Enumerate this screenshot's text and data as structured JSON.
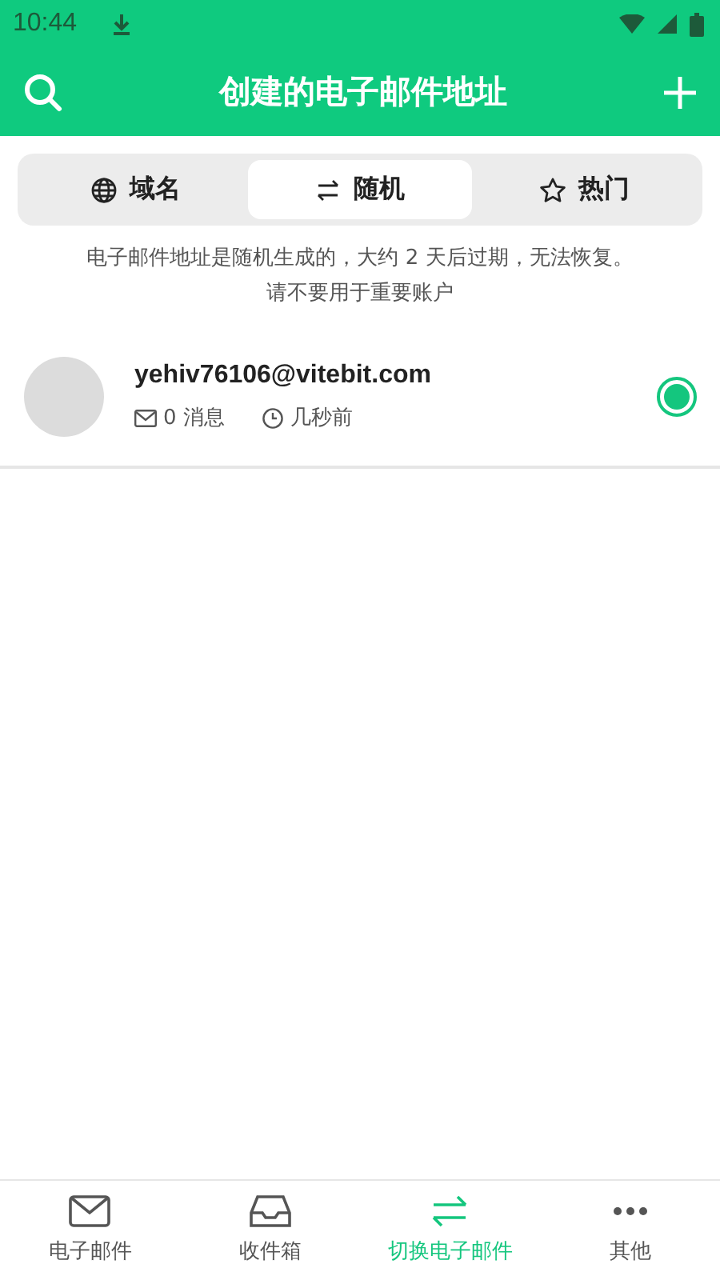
{
  "status_bar": {
    "time": "10:44"
  },
  "app_bar": {
    "title": "创建的电子邮件地址"
  },
  "tabs": [
    {
      "kind": "globe",
      "label": "域名",
      "selected": false
    },
    {
      "kind": "swap",
      "label": "随机",
      "selected": true
    },
    {
      "kind": "star",
      "label": "热门",
      "selected": false
    }
  ],
  "notice": [
    "电子邮件地址是随机生成的，大约 2 天后过期，无法恢复。",
    "请不要用于重要账户"
  ],
  "addresses": [
    {
      "email": "yehiv76106@vitebit.com",
      "messages": "0 消息",
      "time": "几秒前",
      "selected": true
    }
  ],
  "bottom_nav": [
    {
      "kind": "mail",
      "label": "电子邮件",
      "selected": false
    },
    {
      "kind": "inbox",
      "label": "收件箱",
      "selected": false
    },
    {
      "kind": "swap",
      "label": "切换电子邮件",
      "selected": true
    },
    {
      "kind": "more",
      "label": "其他",
      "selected": false
    }
  ]
}
